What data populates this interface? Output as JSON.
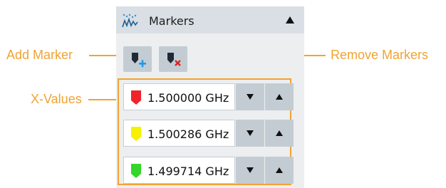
{
  "annotations": {
    "add_marker": "Add Marker",
    "remove_markers": "Remove Markers",
    "x_values": "X-Values"
  },
  "panel": {
    "title": "Markers",
    "header_icon": "markers-trace-icon",
    "collapse_icon": "triangle-up-icon"
  },
  "toolbar": {
    "add_icon": "add-marker-icon",
    "remove_icon": "remove-markers-icon"
  },
  "markers": [
    {
      "value": "1.500000 GHz",
      "color": "#f0242a"
    },
    {
      "value": "1.500286 GHz",
      "color": "#f6f100"
    },
    {
      "value": "1.499714 GHz",
      "color": "#34d62b"
    }
  ],
  "colors": {
    "callout": "#f0a331",
    "panel_bg": "#eceef0",
    "header_bg": "#d9dfe4",
    "button_bg": "#c4ccd3",
    "add_accent": "#1e9bea",
    "remove_accent": "#d9232a"
  }
}
